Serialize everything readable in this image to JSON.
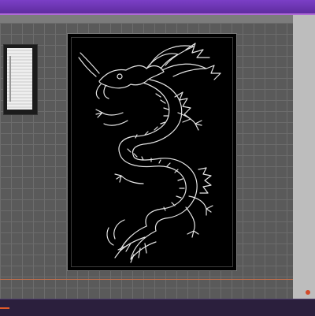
{
  "app": {
    "accent_color": "#7b3fc6",
    "canvas_color": "#5a5a5a",
    "artboard_color": "#000000",
    "artwork_description_icon": "dragon-artwork"
  }
}
